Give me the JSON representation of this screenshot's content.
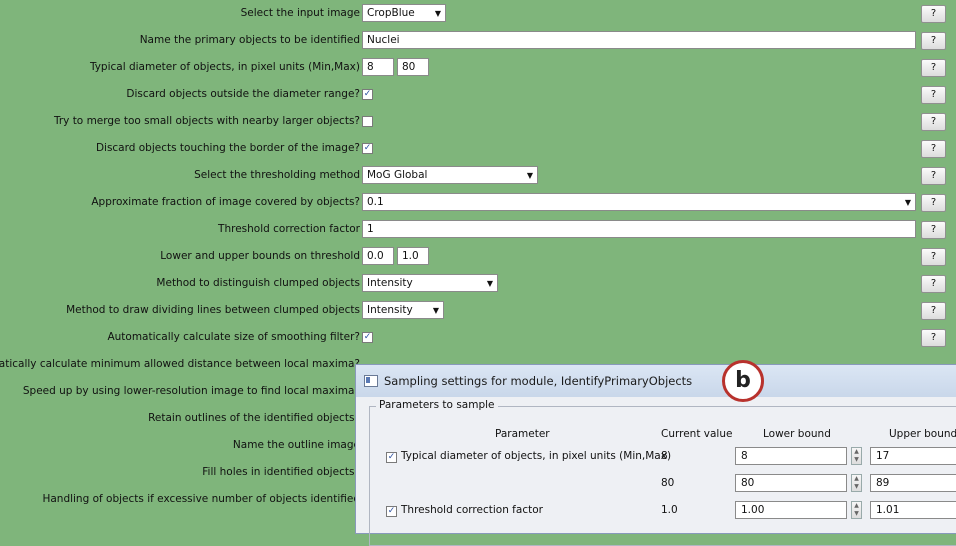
{
  "settings": [
    {
      "label": "Select the input image",
      "type": "combo",
      "value": "CropBlue",
      "width": 84
    },
    {
      "label": "Name the primary objects to be identified",
      "type": "text",
      "value": "Nuclei",
      "width": 554
    },
    {
      "label": "Typical diameter of objects, in pixel units (Min,Max)",
      "type": "pair",
      "value": "8",
      "value2": "80"
    },
    {
      "label": "Discard objects outside the diameter range?",
      "type": "check",
      "checked": "✓"
    },
    {
      "label": "Try to merge too small objects with nearby larger objects?",
      "type": "check",
      "checked": ""
    },
    {
      "label": "Discard objects touching the border of the image?",
      "type": "check",
      "checked": "✓"
    },
    {
      "label": "Select the thresholding method",
      "type": "combo",
      "value": "MoG Global",
      "width": 176
    },
    {
      "label": "Approximate fraction of image covered by objects?",
      "type": "combo",
      "value": "0.1",
      "width": 554
    },
    {
      "label": "Threshold correction factor",
      "type": "text",
      "value": "1",
      "width": 554
    },
    {
      "label": "Lower and upper bounds on threshold",
      "type": "pair",
      "value": "0.0",
      "value2": "1.0"
    },
    {
      "label": "Method to distinguish clumped objects",
      "type": "combo",
      "value": "Intensity",
      "width": 136
    },
    {
      "label": "Method to draw dividing lines between clumped objects",
      "type": "combo",
      "value": "Intensity",
      "width": 82
    },
    {
      "label": "Automatically calculate size of smoothing filter?",
      "type": "check",
      "checked": "✓"
    },
    {
      "label": "Automatically calculate minimum allowed distance between local maxima?",
      "type": "none"
    },
    {
      "label": "Speed up by using lower-resolution image to find local maxima?",
      "type": "none"
    },
    {
      "label": "Retain outlines of the identified objects?",
      "type": "none"
    },
    {
      "label": "Name the outline image",
      "type": "none"
    },
    {
      "label": "Fill holes in identified objects?",
      "type": "none"
    },
    {
      "label": "Handling of objects if excessive number of objects identified",
      "type": "none"
    }
  ],
  "help_label": "?",
  "dialog": {
    "title": "Sampling settings for module, IdentifyPrimaryObjects",
    "badge": "b",
    "group_title": "Parameters to sample",
    "headers": {
      "parameter": "Parameter",
      "current": "Current value",
      "lower": "Lower bound",
      "upper": "Upper bound"
    },
    "rows": [
      {
        "param": "Typical diameter of objects, in pixel units (Min,Max)",
        "checked": "✓",
        "current": "8",
        "lower": "8",
        "upper": "17"
      },
      {
        "param": "",
        "checked": "",
        "current": "80",
        "lower": "80",
        "upper": "89"
      },
      {
        "param": "Threshold correction factor",
        "checked": "✓",
        "current": "1.0",
        "lower": "1.00",
        "upper": "1.01"
      }
    ]
  }
}
